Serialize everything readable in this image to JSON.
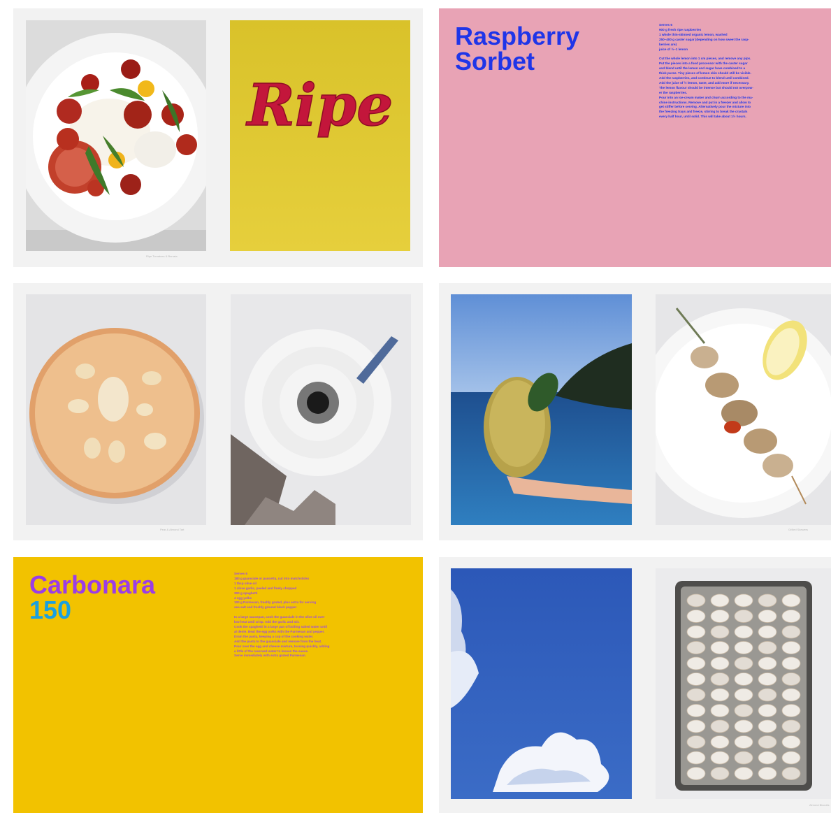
{
  "spreads": [
    {
      "background": "#f2f2f2",
      "photos": [
        {
          "icon": "tomato-burrata-plate-photo"
        },
        {
          "icon": "ripe-lettering-photo",
          "lettering": "Ripe"
        }
      ],
      "caption": "Ripe Tomatoes & Burrata"
    },
    {
      "background": "#e8a3b5",
      "text_color": "#1f35e8",
      "title_lines": [
        "Raspberry",
        "Sorbet"
      ],
      "recipe_text": "Serves 6\n900 g fresh ripe raspberries\n1 whole thin-skinned organic lemon, washed\n250–400 g caster sugar (depending on how sweet the rasp-\nberries are)\njuice of ½–1 lemon\n\nCut the whole lemon into 1 cm pieces, and remove any pips.\nPut the pieces into a food processor with the caster sugar\nand blend until the lemon and sugar have combined to a\nthick puree. Tiny pieces of lemon skin should still be visible.\nAdd the raspberries, and continue to blend until combined.\nAdd the juice of ½ lemon, taste, and add more if necessary.\nThe lemon flavour should be intense but should not overpow-\ner the raspberries.\nPour into an ice-cream maker and churn according to the ma-\nchine instructions. Remove and put in a freezer and allow to\nget stiffer before serving. Alternatively pour the mixture into\nthe freezing trays and freeze, stirring to break the crystals\nevery half hour, until solid. This will take about 1½ hours."
    },
    {
      "background": "#f2f2f2",
      "photos": [
        {
          "icon": "pear-almond-tart-photo"
        },
        {
          "icon": "spiral-staircase-photo"
        }
      ],
      "caption": "Pear & Almond Tart"
    },
    {
      "background": "#f2f2f2",
      "photos": [
        {
          "icon": "lemon-held-over-sea-photo"
        },
        {
          "icon": "grilled-skewer-plate-photo"
        }
      ],
      "caption": "Grilled Skewers"
    },
    {
      "background": "#f2c200",
      "title_line": "Carbonara",
      "title_color": "#9b3de6",
      "number": "150",
      "number_color": "#1aa0e0",
      "text_color": "#a04fd6",
      "recipe_text": "Serves 6\n180 g guanciale or pancetta, cut into matchsticks\n1 tbsp olive oil\n1 clove garlic, peeled and finely chopped\n300 g spaghetti\n4 egg yolks\n100 g Parmesan, freshly grated, plus extra for serving\nsea salt and freshly ground black pepper\n\nIn a large saucepan, cook the guanciale in the olive oil over\nlow heat until crisp. Add the garlic and stir.\nCook the spaghetti in a large pan of boiling salted water until\nal dente. Beat the egg yolks with the Parmesan and pepper.\nDrain the pasta, keeping a cup of the cooking water.\nAdd the pasta to the guanciale and remove from the heat.\nPour over the egg and cheese mixture, tossing quickly, adding\na little of the reserved water to loosen the sauce.\nServe immediately with extra grated Parmesan."
    },
    {
      "background": "#f2f2f2",
      "photos": [
        {
          "icon": "sky-clouds-photo"
        },
        {
          "icon": "biscuits-baking-tray-photo"
        }
      ],
      "caption": "Almond Biscuits"
    }
  ]
}
